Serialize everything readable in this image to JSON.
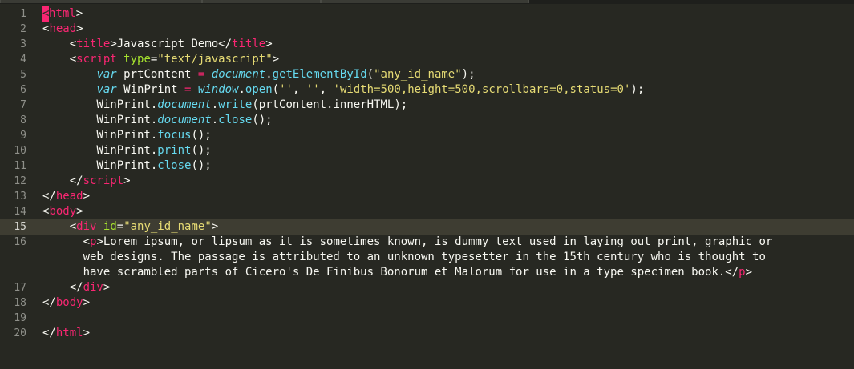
{
  "editor": {
    "active_line": 15,
    "lines": [
      {
        "n": "1",
        "segs": [
          {
            "c": "cursor",
            "t": "<"
          },
          {
            "c": "tag",
            "t": "html"
          },
          {
            "c": "plain",
            "t": ">"
          }
        ]
      },
      {
        "n": "2",
        "segs": [
          {
            "c": "plain",
            "t": "<"
          },
          {
            "c": "tag",
            "t": "head"
          },
          {
            "c": "plain",
            "t": ">"
          }
        ]
      },
      {
        "n": "3",
        "segs": [
          {
            "c": "plain",
            "t": "    <"
          },
          {
            "c": "tag",
            "t": "title"
          },
          {
            "c": "plain",
            "t": ">Javascript Demo</"
          },
          {
            "c": "tag",
            "t": "title"
          },
          {
            "c": "plain",
            "t": ">"
          }
        ]
      },
      {
        "n": "4",
        "segs": [
          {
            "c": "plain",
            "t": "    <"
          },
          {
            "c": "tag",
            "t": "script"
          },
          {
            "c": "plain",
            "t": " "
          },
          {
            "c": "attr",
            "t": "type"
          },
          {
            "c": "plain",
            "t": "="
          },
          {
            "c": "str",
            "t": "\"text/javascript\""
          },
          {
            "c": "plain",
            "t": ">"
          }
        ]
      },
      {
        "n": "5",
        "segs": [
          {
            "c": "plain",
            "t": "        "
          },
          {
            "c": "kw",
            "t": "var"
          },
          {
            "c": "plain",
            "t": " prtContent "
          },
          {
            "c": "op",
            "t": "="
          },
          {
            "c": "plain",
            "t": " "
          },
          {
            "c": "obj",
            "t": "document"
          },
          {
            "c": "plain",
            "t": "."
          },
          {
            "c": "fn",
            "t": "getElementById"
          },
          {
            "c": "plain",
            "t": "("
          },
          {
            "c": "str",
            "t": "\"any_id_name\""
          },
          {
            "c": "plain",
            "t": ");"
          }
        ]
      },
      {
        "n": "6",
        "segs": [
          {
            "c": "plain",
            "t": "        "
          },
          {
            "c": "kw",
            "t": "var"
          },
          {
            "c": "plain",
            "t": " WinPrint "
          },
          {
            "c": "op",
            "t": "="
          },
          {
            "c": "plain",
            "t": " "
          },
          {
            "c": "obj",
            "t": "window"
          },
          {
            "c": "plain",
            "t": "."
          },
          {
            "c": "fn",
            "t": "open"
          },
          {
            "c": "plain",
            "t": "("
          },
          {
            "c": "str",
            "t": "''"
          },
          {
            "c": "plain",
            "t": ", "
          },
          {
            "c": "str",
            "t": "''"
          },
          {
            "c": "plain",
            "t": ", "
          },
          {
            "c": "str",
            "t": "'width=500,height=500,scrollbars=0,status=0'"
          },
          {
            "c": "plain",
            "t": ");"
          }
        ]
      },
      {
        "n": "7",
        "segs": [
          {
            "c": "plain",
            "t": "        WinPrint."
          },
          {
            "c": "obj",
            "t": "document"
          },
          {
            "c": "plain",
            "t": "."
          },
          {
            "c": "fn",
            "t": "write"
          },
          {
            "c": "plain",
            "t": "(prtContent.innerHTML);"
          }
        ]
      },
      {
        "n": "8",
        "segs": [
          {
            "c": "plain",
            "t": "        WinPrint."
          },
          {
            "c": "obj",
            "t": "document"
          },
          {
            "c": "plain",
            "t": "."
          },
          {
            "c": "fn",
            "t": "close"
          },
          {
            "c": "plain",
            "t": "();"
          }
        ]
      },
      {
        "n": "9",
        "segs": [
          {
            "c": "plain",
            "t": "        WinPrint."
          },
          {
            "c": "fn",
            "t": "focus"
          },
          {
            "c": "plain",
            "t": "();"
          }
        ]
      },
      {
        "n": "10",
        "segs": [
          {
            "c": "plain",
            "t": "        WinPrint."
          },
          {
            "c": "fn",
            "t": "print"
          },
          {
            "c": "plain",
            "t": "();"
          }
        ]
      },
      {
        "n": "11",
        "segs": [
          {
            "c": "plain",
            "t": "        WinPrint."
          },
          {
            "c": "fn",
            "t": "close"
          },
          {
            "c": "plain",
            "t": "();"
          }
        ]
      },
      {
        "n": "12",
        "segs": [
          {
            "c": "plain",
            "t": "    </"
          },
          {
            "c": "tag",
            "t": "script"
          },
          {
            "c": "plain",
            "t": ">"
          }
        ]
      },
      {
        "n": "13",
        "segs": [
          {
            "c": "plain",
            "t": "</"
          },
          {
            "c": "tag",
            "t": "head"
          },
          {
            "c": "plain",
            "t": ">"
          }
        ]
      },
      {
        "n": "14",
        "segs": [
          {
            "c": "plain",
            "t": "<"
          },
          {
            "c": "tag",
            "t": "body"
          },
          {
            "c": "plain",
            "t": ">"
          }
        ]
      },
      {
        "n": "15",
        "segs": [
          {
            "c": "plain",
            "t": "    <"
          },
          {
            "c": "tag",
            "t": "div"
          },
          {
            "c": "plain",
            "t": " "
          },
          {
            "c": "attr",
            "t": "id"
          },
          {
            "c": "plain",
            "t": "="
          },
          {
            "c": "str",
            "t": "\"any_id_name\""
          },
          {
            "c": "plain",
            "t": ">"
          }
        ]
      },
      {
        "n": "16",
        "segs": [
          {
            "c": "plain",
            "t": "      <"
          },
          {
            "c": "tag",
            "t": "p"
          },
          {
            "c": "plain",
            "t": ">Lorem ipsum, or lipsum as it is sometimes known, is dummy text used in laying out print, graphic or"
          }
        ]
      },
      {
        "n": "",
        "segs": [
          {
            "c": "plain",
            "t": "      web designs. The passage is attributed to an unknown typesetter in the 15th century who is thought to"
          }
        ]
      },
      {
        "n": "",
        "segs": [
          {
            "c": "plain",
            "t": "      have scrambled parts of Cicero's De Finibus Bonorum et Malorum for use in a type specimen book.</"
          },
          {
            "c": "tag",
            "t": "p"
          },
          {
            "c": "plain",
            "t": ">"
          }
        ]
      },
      {
        "n": "17",
        "segs": [
          {
            "c": "plain",
            "t": "    </"
          },
          {
            "c": "tag",
            "t": "div"
          },
          {
            "c": "plain",
            "t": ">"
          }
        ]
      },
      {
        "n": "18",
        "segs": [
          {
            "c": "plain",
            "t": "</"
          },
          {
            "c": "tag",
            "t": "body"
          },
          {
            "c": "plain",
            "t": ">"
          }
        ]
      },
      {
        "n": "19",
        "segs": []
      },
      {
        "n": "20",
        "segs": [
          {
            "c": "plain",
            "t": "</"
          },
          {
            "c": "tag",
            "t": "html"
          },
          {
            "c": "plain",
            "t": ">"
          }
        ]
      }
    ]
  }
}
